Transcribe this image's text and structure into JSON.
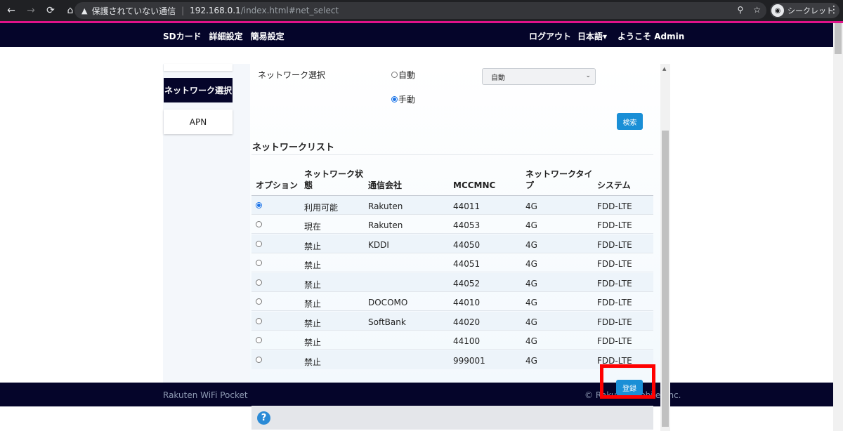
{
  "browser": {
    "security_warning": "保護されていない通信",
    "url_host": "192.168.0.1",
    "url_path": "/index.html#net_select",
    "incognito_label": "シークレット"
  },
  "header": {
    "left_items": [
      "SDカード",
      "詳細設定",
      "簡易設定"
    ],
    "logout": "ログアウト",
    "language": "日本語▾",
    "welcome": "ようこそ Admin"
  },
  "sidebar": {
    "items": [
      {
        "label": "ネットワーク選択",
        "active": true
      },
      {
        "label": "APN",
        "active": false
      }
    ]
  },
  "network_select": {
    "label": "ネットワーク選択",
    "option_auto": "自動",
    "option_manual": "手動",
    "selected_mode": "手動",
    "dropdown_value": "自動",
    "search_button": "検索"
  },
  "network_list": {
    "title": "ネットワークリスト",
    "headers": [
      "オプション",
      "ネットワーク状\n態",
      "通信会社",
      "MCCMNC",
      "ネットワークタイ\nプ",
      "システム"
    ],
    "rows": [
      {
        "selected": true,
        "status": "利用可能",
        "carrier": "Rakuten",
        "mccmnc": "44011",
        "type": "4G",
        "system": "FDD-LTE"
      },
      {
        "selected": false,
        "status": "現在",
        "carrier": "Rakuten",
        "mccmnc": "44053",
        "type": "4G",
        "system": "FDD-LTE"
      },
      {
        "selected": false,
        "status": "禁止",
        "carrier": "KDDI",
        "mccmnc": "44050",
        "type": "4G",
        "system": "FDD-LTE"
      },
      {
        "selected": false,
        "status": "禁止",
        "carrier": "",
        "mccmnc": "44051",
        "type": "4G",
        "system": "FDD-LTE"
      },
      {
        "selected": false,
        "status": "禁止",
        "carrier": "",
        "mccmnc": "44052",
        "type": "4G",
        "system": "FDD-LTE"
      },
      {
        "selected": false,
        "status": "禁止",
        "carrier": "DOCOMO",
        "mccmnc": "44010",
        "type": "4G",
        "system": "FDD-LTE"
      },
      {
        "selected": false,
        "status": "禁止",
        "carrier": "SoftBank",
        "mccmnc": "44020",
        "type": "4G",
        "system": "FDD-LTE"
      },
      {
        "selected": false,
        "status": "禁止",
        "carrier": "",
        "mccmnc": "44100",
        "type": "4G",
        "system": "FDD-LTE"
      },
      {
        "selected": false,
        "status": "禁止",
        "carrier": "",
        "mccmnc": "999001",
        "type": "4G",
        "system": "FDD-LTE"
      }
    ]
  },
  "submit_button": "登録",
  "footer": {
    "left": "Rakuten WiFi Pocket",
    "right": "© Rakuten Mobile, Inc."
  },
  "colors": {
    "header_bg": "#05052a",
    "accent_pink": "#e0128a",
    "button_blue": "#1a8fd6",
    "highlight_red": "#ff0000"
  }
}
